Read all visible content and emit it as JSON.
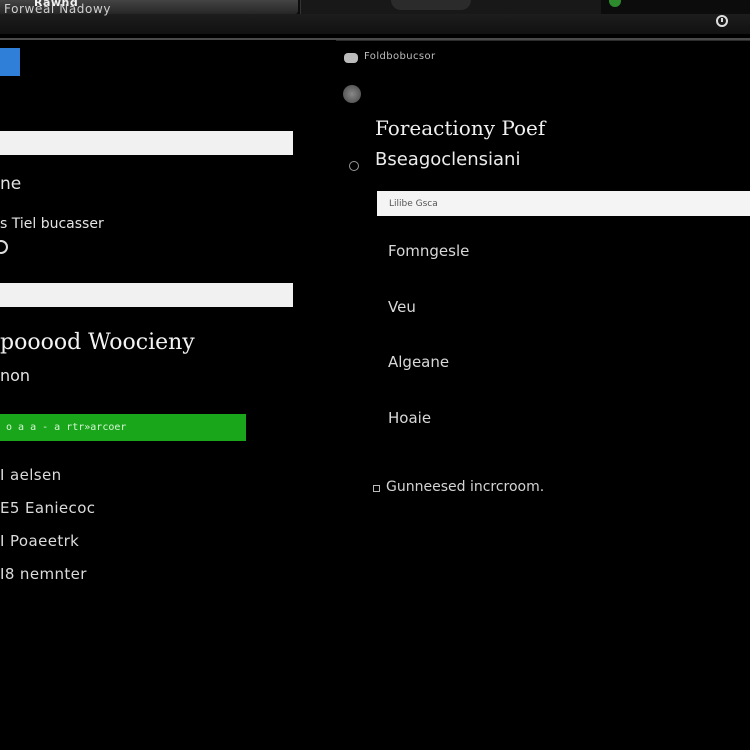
{
  "window": {
    "tab_title": "Rawnd",
    "title": "Forweal Nadowy",
    "clock_icon": "clock-icon"
  },
  "left_panel": {
    "logo_icon": "app-logo-icon",
    "label_1": "ne",
    "label_2": "s Tiel bucasser",
    "heading": "pooood Woocieny",
    "subheading": "non",
    "green_button_label": "o a a - a rtr»arcoer",
    "list": [
      "I aelsen",
      "E5 Eaniecoc",
      "I Poaeetrk",
      "I8 nemnter"
    ]
  },
  "right_panel": {
    "header_text": "Foldbobucsor",
    "title": "Foreactiony Poef",
    "subtitle": "Bseagoclensiani",
    "input_text": "Lilibe Gsca",
    "items": [
      "Fomngesle",
      "Veu",
      "Algeane",
      "Hoaie"
    ],
    "footer": "Gunneesed incrcroom."
  },
  "colors": {
    "background": "#000000",
    "accent_green": "#1aa61a",
    "accent_blue": "#2f7fd8"
  }
}
